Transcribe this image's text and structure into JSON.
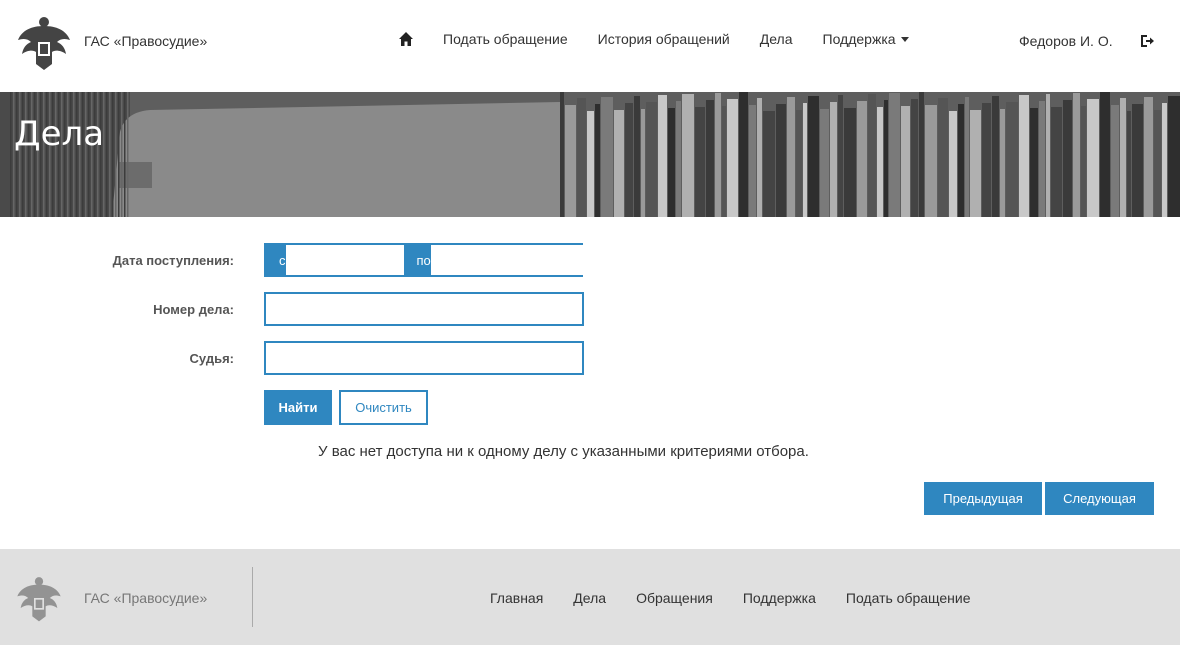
{
  "header": {
    "brand": "ГАС «Правосудие»",
    "nav": [
      {
        "label": "Подать обращение"
      },
      {
        "label": "История обращений"
      },
      {
        "label": "Дела"
      },
      {
        "label": "Поддержка"
      }
    ],
    "user": "Федоров И. О."
  },
  "banner": {
    "title": "Дела"
  },
  "form": {
    "date_label": "Дата поступления:",
    "from_addon": "с",
    "to_addon": "по",
    "date_from_value": "",
    "date_to_value": "",
    "case_number_label": "Номер дела:",
    "case_number_value": "",
    "judge_label": "Судья:",
    "judge_value": "",
    "search_button": "Найти",
    "clear_button": "Очистить"
  },
  "message": "У вас нет доступа ни к одному делу с указанными критериями отбора.",
  "pagination": {
    "prev": "Предыдущая",
    "next": "Следующая"
  },
  "footer": {
    "brand": "ГАС «Правосудие»",
    "nav": [
      {
        "label": "Главная"
      },
      {
        "label": "Дела"
      },
      {
        "label": "Обращения"
      },
      {
        "label": "Поддержка"
      },
      {
        "label": "Подать обращение"
      }
    ]
  },
  "colors": {
    "accent": "#2f87c0",
    "footer_bg": "#e0e0e0",
    "banner_bg": "#6f6f6f"
  },
  "icons": {
    "logo": "coat-of-arms-icon",
    "home": "home-icon",
    "logout": "logout-icon",
    "dropdown": "caret-down-icon"
  }
}
